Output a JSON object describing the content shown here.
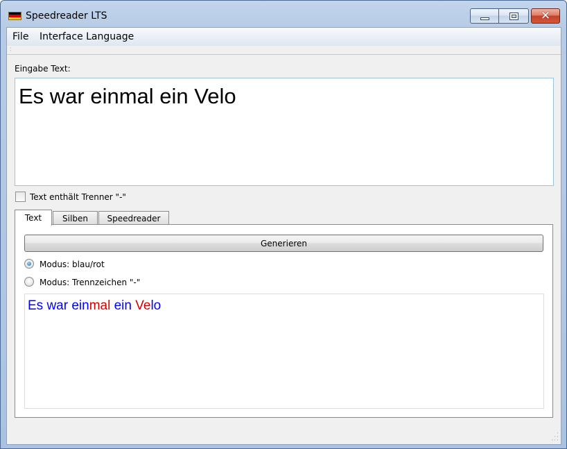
{
  "window": {
    "title": "Speedreader LTS",
    "icon": "german-flag-icon",
    "flag_colors": [
      "#000000",
      "#dd0000",
      "#ffce00"
    ],
    "controls": {
      "minimize": "minimize-icon",
      "maximize": "maximize-icon",
      "close_glyph": "✕"
    }
  },
  "menubar": {
    "items": [
      "File",
      "Interface Language"
    ]
  },
  "input": {
    "label": "Eingabe Text:",
    "value": "Es war einmal ein Velo"
  },
  "options": {
    "checkbox_label": "Text enthält Trenner \"-\"",
    "checkbox_checked": false
  },
  "tabs": {
    "items": [
      "Text",
      "Silben",
      "Speedreader"
    ],
    "active": "Text"
  },
  "text_tab": {
    "generate_label": "Generieren",
    "radio_options": [
      {
        "label": "Modus: blau/rot",
        "checked": true
      },
      {
        "label": "Modus: Trennzeichen \"-\"",
        "checked": false
      }
    ],
    "output_segments": [
      {
        "text": "Es war ein",
        "color": "blue"
      },
      {
        "text": "mal",
        "color": "red"
      },
      {
        "text": " ein ",
        "color": "blue"
      },
      {
        "text": "Ve",
        "color": "red"
      },
      {
        "text": "lo",
        "color": "blue"
      }
    ],
    "colors": {
      "blue": "#0000ff",
      "red": "#d20000"
    }
  }
}
